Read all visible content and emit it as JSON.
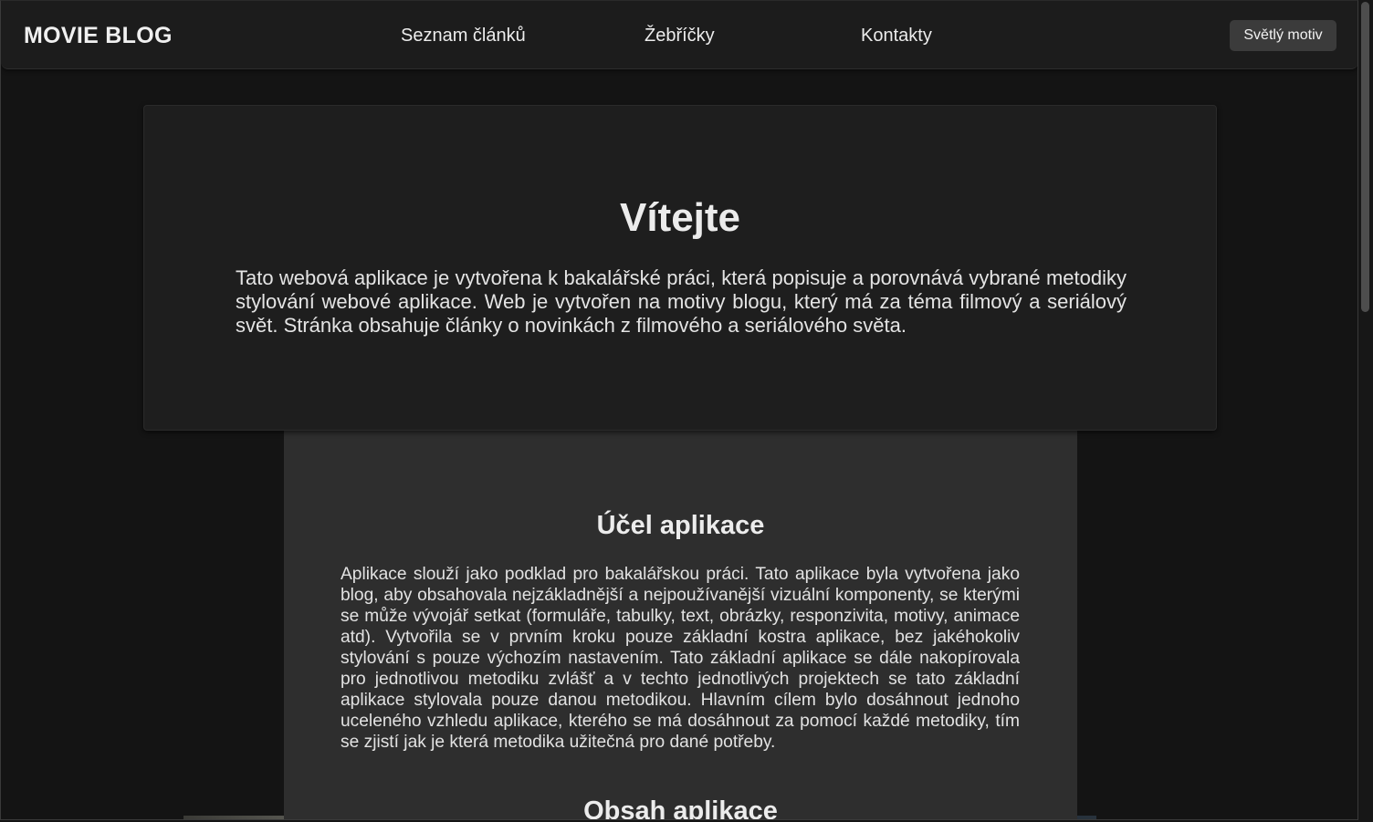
{
  "navbar": {
    "brand": "MOVIE BLOG",
    "links": [
      "Seznam článků",
      "Žebříčky",
      "Kontakty"
    ],
    "theme_button": "Světlý motiv"
  },
  "welcome": {
    "title": "Vítejte",
    "text": "Tato webová aplikace je vytvořena k bakalářské práci, která popisuje a porovnává vybrané metodiky stylování webové aplikace. Web je vytvořen na motivy blogu, který má za téma filmový a seriálový svět. Stránka obsahuje články o novinkách z filmového a seriálového světa."
  },
  "sections": [
    {
      "title": "Účel aplikace",
      "text": "Aplikace slouží jako podklad pro bakalářskou práci. Tato aplikace byla vytvořena jako blog, aby obsahovala nejzákladnější a nejpoužívanější vizuální komponenty, se kterými se může vývojář setkat (formuláře, tabulky, text, obrázky, responzivita, motivy, animace atd). Vytvořila se v prvním kroku pouze základní kostra aplikace, bez jakéhokoliv stylování s pouze výchozím nastavením. Tato základní aplikace se dále nakopírovala pro jednotlivou metodiku zvlášť a v techto jednotlivých projektech se tato základní aplikace stylovala pouze danou metodikou. Hlavním cílem bylo dosáhnout jednoho uceleného vzhledu aplikace, kterého se má dosáhnout za pomocí každé metodiky, tím se zjistí jak je která metodika užitečná pro dané potřeby."
    },
    {
      "title": "Obsah aplikace"
    }
  ],
  "colors": {
    "page_background": "#141414",
    "navbar_background": "#1c1c1c",
    "welcome_card_background": "#1e1e1e",
    "content_card_background": "#2e2e2e",
    "button_background": "#3b3b3b",
    "text": "#e6e6e6"
  }
}
